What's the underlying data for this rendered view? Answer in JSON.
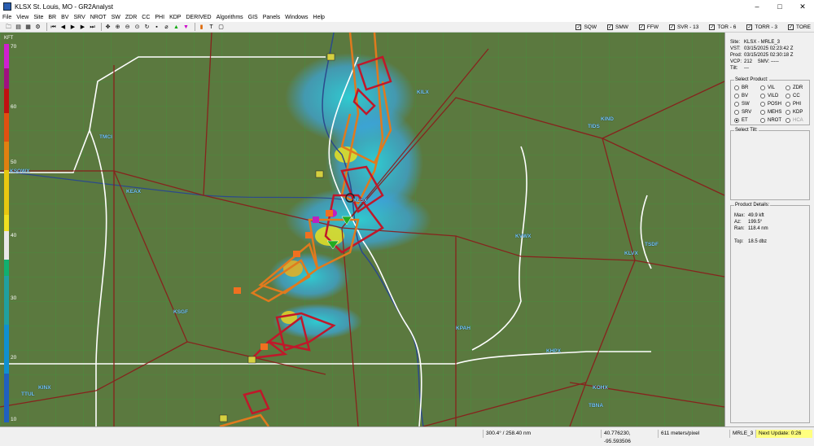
{
  "window": {
    "title": "KLSX St. Louis, MO - GR2Analyst",
    "minimize": "–",
    "maximize": "□",
    "close": "✕"
  },
  "menu": [
    "File",
    "View",
    "Site",
    "BR",
    "BV",
    "SRV",
    "NROT",
    "SW",
    "ZDR",
    "CC",
    "PHI",
    "KDP",
    "DERIVED",
    "Algorithms",
    "GIS",
    "Panels",
    "Windows",
    "Help"
  ],
  "toolbar_icons": [
    "folder-open",
    "save",
    "print",
    "settings",
    "first",
    "prev",
    "play",
    "next",
    "last",
    "pan",
    "zoom-in",
    "zoom-out",
    "zoom-extent",
    "rotate",
    "marker",
    "tornado-marker",
    "green-triangle",
    "magenta-triangle",
    "flag",
    "text-tool",
    "info"
  ],
  "warning_toggles": [
    {
      "label": "SQW",
      "checked": true
    },
    {
      "label": "SMW",
      "checked": true
    },
    {
      "label": "FFW",
      "checked": true
    },
    {
      "label": "SVR - 13",
      "checked": true
    },
    {
      "label": "TOR - 6",
      "checked": true
    },
    {
      "label": "TORR - 3",
      "checked": true
    },
    {
      "label": "TORE",
      "checked": true
    }
  ],
  "colorbar": {
    "unit": "KFT",
    "ticks": [
      "70",
      "60",
      "50",
      "40",
      "30",
      "20",
      "10"
    ]
  },
  "sites": [
    {
      "id": "KLSX"
    },
    {
      "id": "KILX"
    },
    {
      "id": "TMCI"
    },
    {
      "id": "KEAX"
    },
    {
      "id": "KSGF"
    },
    {
      "id": "KINX"
    },
    {
      "id": "TTUL"
    },
    {
      "id": "KPAH"
    },
    {
      "id": "KVWX"
    },
    {
      "id": "KIND"
    },
    {
      "id": "TIDS"
    },
    {
      "id": "KLVX"
    },
    {
      "id": "TSDF"
    },
    {
      "id": "KHPX"
    },
    {
      "id": "KOHX"
    },
    {
      "id": "TBNA"
    },
    {
      "id": "KSOWX"
    }
  ],
  "site_info": {
    "site_label": "Site:",
    "site": "KLSX - MRLE_3",
    "vst_label": "VST:",
    "vst": "03/15/2025  02:23:42 Z",
    "prod_label": "Prod:",
    "prod": "03/15/2025  02:30:18 Z",
    "vcp_label": "VCP:",
    "vcp": "212",
    "smv_label": "SMV:",
    "smv": "-----",
    "tilt_label": "Tilt:",
    "tilt": "---"
  },
  "select_product": {
    "title": "Select Product:",
    "options": [
      {
        "label": "BR",
        "selected": false,
        "disabled": false
      },
      {
        "label": "VIL",
        "selected": false,
        "disabled": false
      },
      {
        "label": "ZDR",
        "selected": false,
        "disabled": false
      },
      {
        "label": "BV",
        "selected": false,
        "disabled": false
      },
      {
        "label": "VILD",
        "selected": false,
        "disabled": false
      },
      {
        "label": "CC",
        "selected": false,
        "disabled": false
      },
      {
        "label": "SW",
        "selected": false,
        "disabled": false
      },
      {
        "label": "POSH",
        "selected": false,
        "disabled": false
      },
      {
        "label": "PHI",
        "selected": false,
        "disabled": false
      },
      {
        "label": "SRV",
        "selected": false,
        "disabled": false
      },
      {
        "label": "MEHS",
        "selected": false,
        "disabled": false
      },
      {
        "label": "KDP",
        "selected": false,
        "disabled": false
      },
      {
        "label": "ET",
        "selected": true,
        "disabled": false
      },
      {
        "label": "NROT",
        "selected": false,
        "disabled": false
      },
      {
        "label": "HCA",
        "selected": false,
        "disabled": true
      }
    ]
  },
  "select_tilt": {
    "title": "Select Tilt:"
  },
  "product_details": {
    "title": "Product Details:",
    "max_label": "Max:",
    "max": "49.9 kft",
    "az_label": "Az:",
    "az": "199.5°",
    "ran_label": "Ran:",
    "ran": "118.4 nm",
    "top_label": "Top:",
    "top": "18.5 dbz"
  },
  "status": {
    "az_range": "300.4° / 258.40 nm",
    "latlon": "40.776230, -95.593506",
    "scale": "611 meters/pixel",
    "mode": "MRLE_3",
    "next_update": "Next Update: 0:26"
  },
  "colors": {
    "warning_red": "#c0182a",
    "warning_orange": "#e07a1e",
    "state_line": "#ffffff",
    "road": "#8b1a1a",
    "county": "#3c9a3c",
    "next_update_bg": "#ffff80"
  }
}
